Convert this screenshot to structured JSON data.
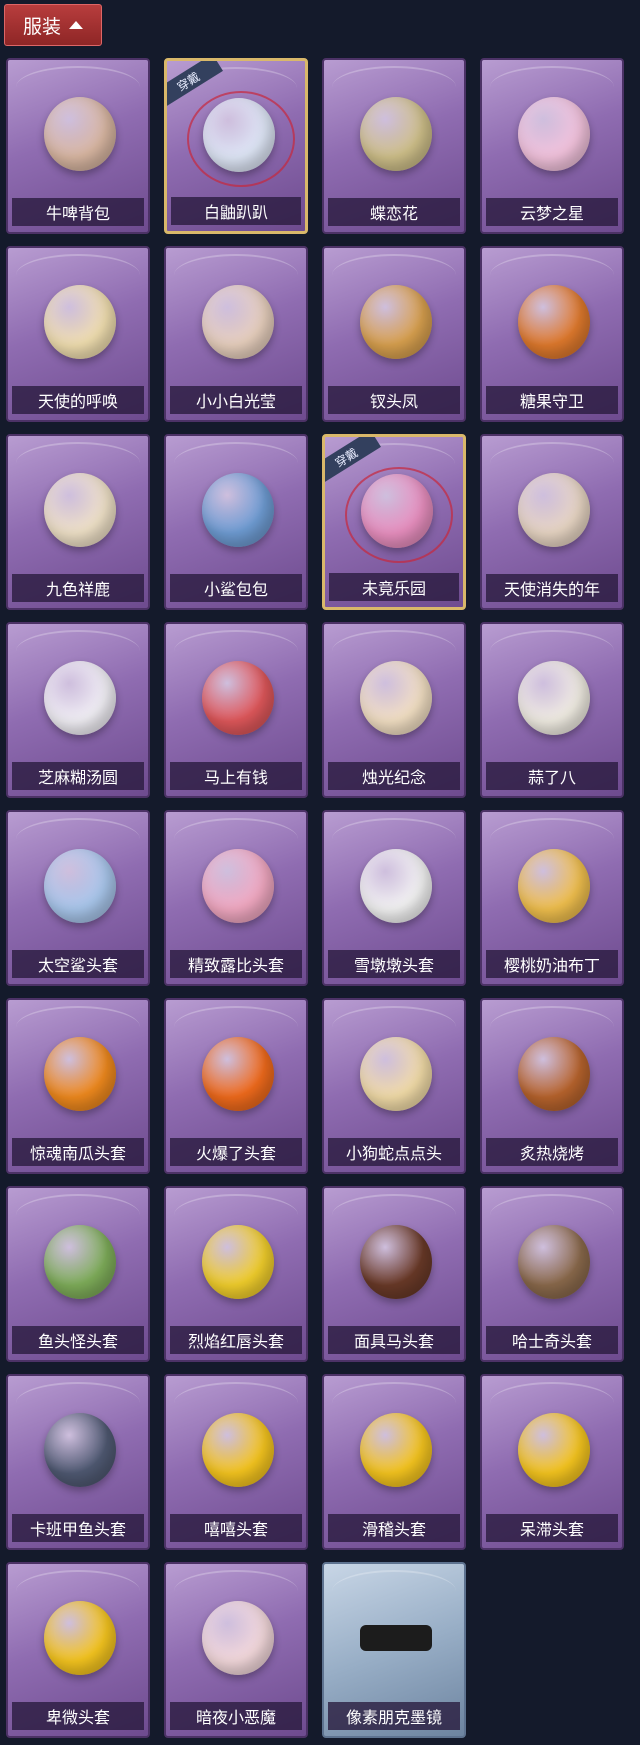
{
  "header": {
    "label": "服装"
  },
  "equipped_badge": "穿戴",
  "items": [
    {
      "name": "牛啤背包",
      "color": "#d9b7a2",
      "icon": "cow-backpack-icon",
      "equipped": false
    },
    {
      "name": "白鼬趴趴",
      "color": "#dfe7f7",
      "icon": "ferret-plush-icon",
      "equipped": true
    },
    {
      "name": "蝶恋花",
      "color": "#cfc08a",
      "icon": "butterfly-ornament-icon",
      "equipped": false
    },
    {
      "name": "云梦之星",
      "color": "#f3c3dd",
      "icon": "unicorn-cloud-icon",
      "equipped": false
    },
    {
      "name": "天使的呼唤",
      "color": "#f1dfb0",
      "icon": "angel-figure-icon",
      "equipped": false
    },
    {
      "name": "小小白光莹",
      "color": "#e8d0be",
      "icon": "doll-figure-icon",
      "equipped": false
    },
    {
      "name": "钗头凤",
      "color": "#d9a14f",
      "icon": "phoenix-crown-icon",
      "equipped": false
    },
    {
      "name": "糖果守卫",
      "color": "#e07a2d",
      "icon": "pumpkin-guard-icon",
      "equipped": false
    },
    {
      "name": "九色祥鹿",
      "color": "#f0e2c8",
      "icon": "deer-icon",
      "equipped": false
    },
    {
      "name": "小鲨包包",
      "color": "#6f9dd4",
      "icon": "shark-bag-icon",
      "equipped": false
    },
    {
      "name": "未竟乐园",
      "color": "#e88fbf",
      "icon": "paradise-doll-icon",
      "equipped": true
    },
    {
      "name": "天使消失的年",
      "color": "#e8d6c4",
      "icon": "veiled-doll-icon",
      "equipped": false
    },
    {
      "name": "芝麻糊汤圆",
      "color": "#f2f0f6",
      "icon": "rice-ball-icon",
      "equipped": false
    },
    {
      "name": "马上有钱",
      "color": "#e0585b",
      "icon": "horse-head-icon",
      "equipped": false
    },
    {
      "name": "烛光纪念",
      "color": "#f3e0c4",
      "icon": "candle-icon",
      "equipped": false
    },
    {
      "name": "蒜了八",
      "color": "#f1ede3",
      "icon": "garlic-icon",
      "equipped": false
    },
    {
      "name": "太空鲨头套",
      "color": "#a9c7ec",
      "icon": "shark-mask-icon",
      "equipped": false
    },
    {
      "name": "精致露比头套",
      "color": "#f2a9c2",
      "icon": "beaver-mask-icon",
      "equipped": false
    },
    {
      "name": "雪墩墩头套",
      "color": "#f4f4f4",
      "icon": "snowman-mask-icon",
      "equipped": false
    },
    {
      "name": "樱桃奶油布丁",
      "color": "#f1c04e",
      "icon": "pudding-icon",
      "equipped": false
    },
    {
      "name": "惊魂南瓜头套",
      "color": "#f08a1e",
      "icon": "pumpkin-mask-icon",
      "equipped": false
    },
    {
      "name": "火爆了头套",
      "color": "#f16b1c",
      "icon": "fire-mask-icon",
      "equipped": false
    },
    {
      "name": "小狗蛇点点头",
      "color": "#f2dca8",
      "icon": "dog-snake-mask-icon",
      "equipped": false
    },
    {
      "name": "炙热烧烤",
      "color": "#b8642d",
      "icon": "bbq-mask-icon",
      "equipped": false
    },
    {
      "name": "鱼头怪头套",
      "color": "#7fae5a",
      "icon": "fish-mask-icon",
      "equipped": false
    },
    {
      "name": "烈焰红唇头套",
      "color": "#f2cf2c",
      "icon": "yellow-mask-icon",
      "equipped": false
    },
    {
      "name": "面具马头套",
      "color": "#6a3a28",
      "icon": "horse-mask-icon",
      "equipped": false
    },
    {
      "name": "哈士奇头套",
      "color": "#8b6a4c",
      "icon": "husky-mask-icon",
      "equipped": false
    },
    {
      "name": "卡班甲鱼头套",
      "color": "#505a73",
      "icon": "turtle-mask-icon",
      "equipped": false
    },
    {
      "name": "嘻嘻头套",
      "color": "#f6c61f",
      "icon": "grin-mask-icon",
      "equipped": false
    },
    {
      "name": "滑稽头套",
      "color": "#f6c61f",
      "icon": "funny-face-mask-icon",
      "equipped": false
    },
    {
      "name": "呆滞头套",
      "color": "#f6c61f",
      "icon": "dazed-face-mask-icon",
      "equipped": false
    },
    {
      "name": "卑微头套",
      "color": "#f6c61f",
      "icon": "humble-face-mask-icon",
      "equipped": false
    },
    {
      "name": "暗夜小恶魔",
      "color": "#f4d9dc",
      "icon": "devil-mannequin-icon",
      "equipped": false
    },
    {
      "name": "像素朋克墨镜",
      "color": "#1c1c1c",
      "icon": "pixel-sunglasses-icon",
      "equipped": false,
      "special": true
    }
  ]
}
